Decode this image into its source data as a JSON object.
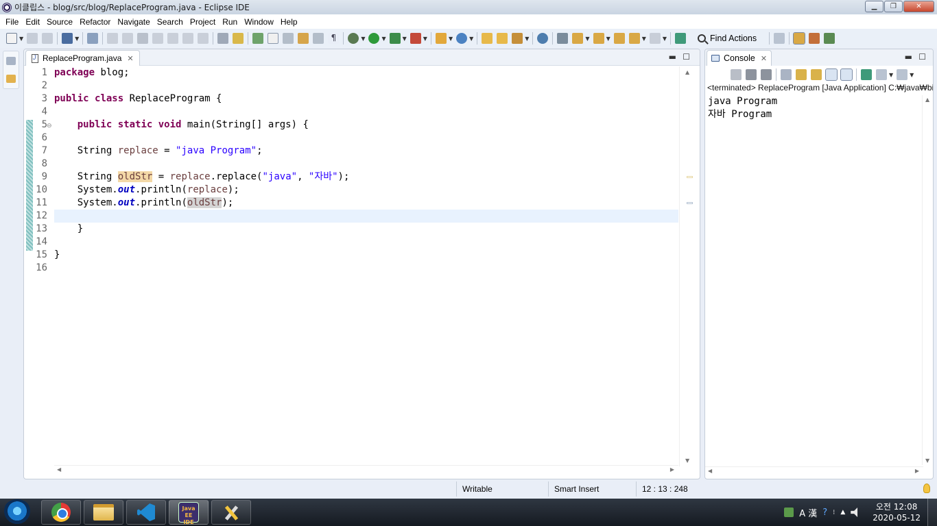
{
  "window": {
    "title": "이클립스 - blog/src/blog/ReplaceProgram.java - Eclipse IDE",
    "controls": {
      "minimize": "▁",
      "maximize": "❐",
      "close": "✕"
    }
  },
  "menu": [
    "File",
    "Edit",
    "Source",
    "Refactor",
    "Navigate",
    "Search",
    "Project",
    "Run",
    "Window",
    "Help"
  ],
  "toolbar": {
    "find_actions_label": "Find Actions"
  },
  "editor": {
    "tab_label": "ReplaceProgram.java",
    "tab_close": "✕",
    "line_numbers": [
      "1",
      "2",
      "3",
      "4",
      "5",
      "6",
      "7",
      "8",
      "9",
      "10",
      "11",
      "12",
      "13",
      "14",
      "15",
      "16"
    ],
    "fold_marker": "⊖",
    "tokens": {
      "package": "package",
      "blog_semi": " blog;",
      "public": "public",
      "class": "class",
      "class_name": " ReplaceProgram {",
      "static": "static",
      "void": "void",
      "main_sig": " main(String[] args) {",
      "string_type": "String ",
      "replace_var": "replace",
      "assign": " = ",
      "java_program_str": "\"java Program\"",
      "semi": ";",
      "oldstr_var": "oldStr",
      "replace_call": ".replace(",
      "java_str": "\"java\"",
      "comma": ", ",
      "jaba_str": "\"자바\"",
      "close_paren_semi": ");",
      "system": "System.",
      "out": "out",
      "println_open": ".println(",
      "close_brace": "}"
    }
  },
  "console": {
    "tab_label": "Console",
    "tab_close": "✕",
    "header": "<terminated> ReplaceProgram [Java Application] C:₩java₩bin",
    "output": [
      "java Program",
      "자바 Program"
    ]
  },
  "status": {
    "writable": "Writable",
    "insert_mode": "Smart Insert",
    "position": "12 : 13 : 248"
  },
  "taskbar": {
    "eclipse_label": "Java EE IDE",
    "tray_ime": "A 漢",
    "clock_time": "오전 12:08",
    "clock_date": "2020-05-12"
  }
}
